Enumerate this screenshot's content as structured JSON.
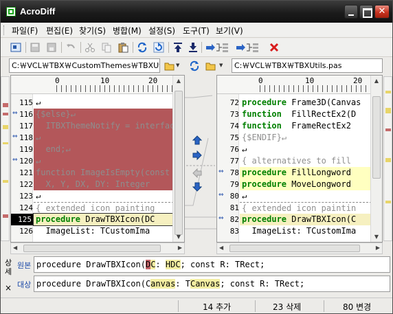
{
  "window": {
    "title": "AcroDiff"
  },
  "menu": [
    {
      "label": "파일(F)"
    },
    {
      "label": "편집(E)"
    },
    {
      "label": "찾기(S)"
    },
    {
      "label": "병합(M)"
    },
    {
      "label": "설정(S)"
    },
    {
      "label": "도구(T)"
    },
    {
      "label": "보기(V)"
    }
  ],
  "toolbar_icons": [
    "open-icon",
    "save-icon",
    "save-all-icon",
    "undo-icon",
    "cut-icon",
    "copy-icon",
    "paste-icon",
    "refresh-compare-icon",
    "reload-icon",
    "first-diff-icon",
    "last-diff-icon",
    "copy-to-right-icon",
    "copy-to-left-icon",
    "close-red-icon"
  ],
  "paths": {
    "left": "C:￦VCL￦TBX￦CustomThemes￦TBXUtils",
    "right": "C:￦VCL￦TBX￦TBXUtils.pas"
  },
  "ruler": {
    "left_ticks": [
      "0",
      "10",
      "20"
    ],
    "right_ticks": [
      "0",
      "10",
      "20"
    ]
  },
  "left_pane": {
    "lines": [
      {
        "num": "115",
        "text": "↵",
        "style": "plain"
      },
      {
        "num": "116",
        "text": "{$else}↵",
        "style": "deleted"
      },
      {
        "num": "117",
        "text": "  ITBXThemeNotify = interface",
        "style": "deleted"
      },
      {
        "num": "118",
        "text": "↵",
        "style": "deleted"
      },
      {
        "num": "119",
        "text": "  end;↵",
        "style": "deleted"
      },
      {
        "num": "120",
        "text": "↵",
        "style": "deleted"
      },
      {
        "num": "121",
        "text": "function ImageIsEmpty(const",
        "style": "deleted"
      },
      {
        "num": "122",
        "text": "  X, Y, DX, DY: Integer",
        "style": "deleted"
      },
      {
        "num": "123",
        "text": "↵",
        "style": "plain"
      },
      {
        "num": "124",
        "text": "{ extended icon painting",
        "style": "comment"
      },
      {
        "num": "125",
        "text": "procedure DrawTBXIcon(DC",
        "style": "current"
      },
      {
        "num": "126",
        "text": "  ImageList: TCustomIma",
        "style": "plain"
      }
    ]
  },
  "right_pane": {
    "lines": [
      {
        "num": "72",
        "text": "procedure Frame3D(Canvas",
        "style": "plain"
      },
      {
        "num": "73",
        "text": "function  FillRectEx2(D",
        "style": "plain"
      },
      {
        "num": "74",
        "text": "function  FrameRectEx2",
        "style": "plain"
      },
      {
        "num": "75",
        "text": "{$ENDIF}↵",
        "style": "plaincm"
      },
      {
        "num": "76",
        "text": "↵",
        "style": "plain"
      },
      {
        "num": "77",
        "text": "{ alternatives to fill",
        "style": "plaincm"
      },
      {
        "num": "78",
        "text": "procedure FillLongword",
        "style": "added"
      },
      {
        "num": "79",
        "text": "procedure MoveLongword",
        "style": "added"
      },
      {
        "num": "80",
        "text": "↵",
        "style": "plain"
      },
      {
        "num": "81",
        "text": "{ extended icon paintin",
        "style": "comment"
      },
      {
        "num": "82",
        "text": "procedure DrawTBXIcon(C",
        "style": "changed"
      },
      {
        "num": "83",
        "text": "  ImageList: TCustomIma",
        "style": "plain"
      }
    ]
  },
  "detail": {
    "side_label": "상세",
    "source_label": "원본",
    "target_label": "대상",
    "source_line": "procedure DrawTBXIcon(DC: HDC; const R: TRect;",
    "target_line": "procedure DrawTBXIcon(Canvas: TCanvas; const R: TRect;",
    "close": "×"
  },
  "status": {
    "added": "14 추가",
    "deleted": "23 삭제",
    "changed": "80 변경"
  },
  "colors": {
    "deleted": "#b3575a",
    "added": "#ffffc0",
    "changed": "#f6f0c0",
    "keyword": "#008000",
    "title_bg": "#1b1b1b"
  }
}
